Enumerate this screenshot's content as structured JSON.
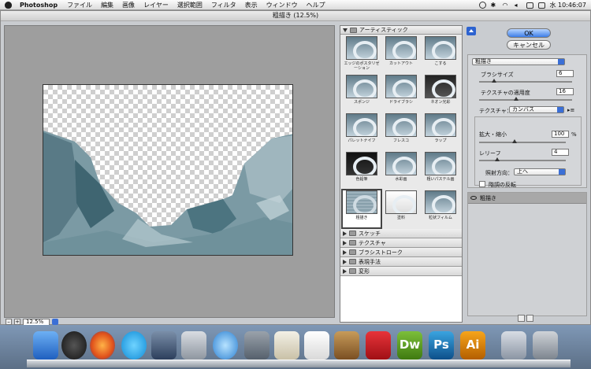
{
  "menubar": {
    "app": "Photoshop",
    "menus": [
      "ファイル",
      "編集",
      "画像",
      "レイヤー",
      "選択範囲",
      "フィルタ",
      "表示",
      "ウィンドウ",
      "ヘルプ"
    ],
    "clock": "水 10:46:07"
  },
  "dialog": {
    "title": "粗描き (12.5%)",
    "zoom": "12.5%"
  },
  "gallery": {
    "category": "アーティスティック",
    "filters": [
      {
        "label": "エッジのポスタリゼーション",
        "selected": false
      },
      {
        "label": "カットアウト",
        "selected": false
      },
      {
        "label": "こする",
        "selected": false
      },
      {
        "label": "スポンジ",
        "selected": false
      },
      {
        "label": "ドライブラシ",
        "selected": false
      },
      {
        "label": "ネオン光彩",
        "selected": false
      },
      {
        "label": "パレットナイフ",
        "selected": false
      },
      {
        "label": "フレスコ",
        "selected": false
      },
      {
        "label": "ラップ",
        "selected": false
      },
      {
        "label": "色鉛筆",
        "selected": false
      },
      {
        "label": "水彩画",
        "selected": false
      },
      {
        "label": "粗いパステル画",
        "selected": false
      },
      {
        "label": "粗描き",
        "selected": true
      },
      {
        "label": "塗料",
        "selected": false
      },
      {
        "label": "粒状フィルム",
        "selected": false
      }
    ],
    "other_categories": [
      "スケッチ",
      "テクスチャ",
      "ブラシストローク",
      "表現手法",
      "変形"
    ]
  },
  "buttons": {
    "ok": "OK",
    "cancel": "キャンセル"
  },
  "settings": {
    "filter_select": "粗描き",
    "brush_size_label": "ブラシサイズ",
    "brush_size": "6",
    "texture_coverage_label": "テクスチャの適用度",
    "texture_coverage": "16",
    "texture_label": "テクスチャ：",
    "texture_value": "カンバス",
    "scaling_label": "拡大・縮小",
    "scaling": "100",
    "scaling_unit": "%",
    "relief_label": "レリーフ",
    "relief": "4",
    "light_label": "照射方向：",
    "light_value": "上へ",
    "invert_label": "階調の反転",
    "invert_checked": false
  },
  "layers": {
    "effect_layer": "粗描き"
  }
}
